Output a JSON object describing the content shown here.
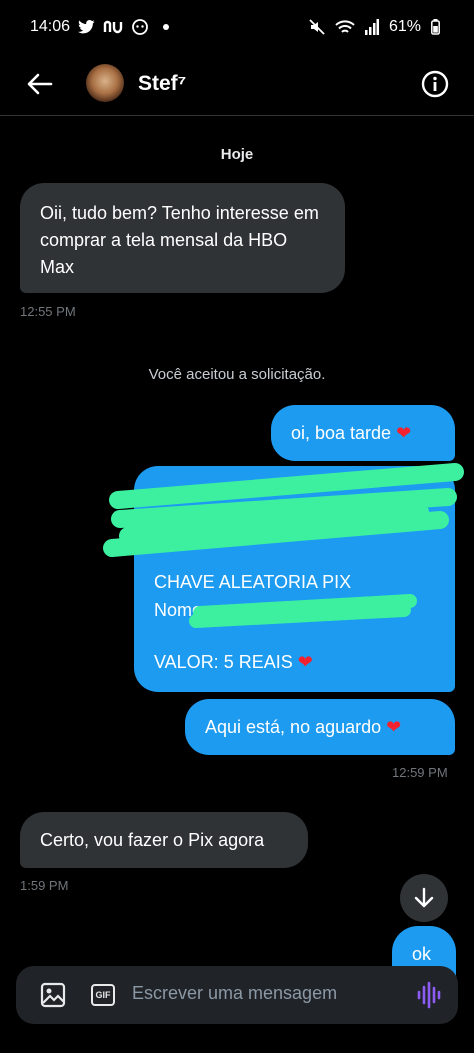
{
  "status_bar": {
    "time": "14:06",
    "battery": "61%"
  },
  "header": {
    "contact_name": "Stef⁷"
  },
  "conversation": {
    "day_label": "Hoje",
    "messages": [
      {
        "from": "them",
        "text": "Oii, tudo bem? Tenho interesse em comprar a tela mensal da HBO Max"
      },
      {
        "time": "12:55 PM"
      },
      {
        "system": "Você aceitou a solicitação."
      },
      {
        "from": "me",
        "text": "oi, boa tarde"
      },
      {
        "from": "me",
        "pix_key": "CHAVE ALEATORIA PIX",
        "name_label": "Nome",
        "value": "VALOR: 5 REAIS"
      },
      {
        "from": "me",
        "text": "Aqui está, no aguardo"
      },
      {
        "time": "12:59 PM"
      },
      {
        "from": "them",
        "text": "Certo, vou fazer o Pix agora"
      },
      {
        "time": "1:59 PM"
      },
      {
        "from": "me",
        "text": "ok"
      }
    ]
  },
  "composer": {
    "placeholder": "Escrever uma mensagem",
    "gif_label": "GIF"
  },
  "colors": {
    "accent": "#1d9bf0",
    "incoming_bubble": "#2f3336",
    "redaction": "#3cf0a0"
  }
}
